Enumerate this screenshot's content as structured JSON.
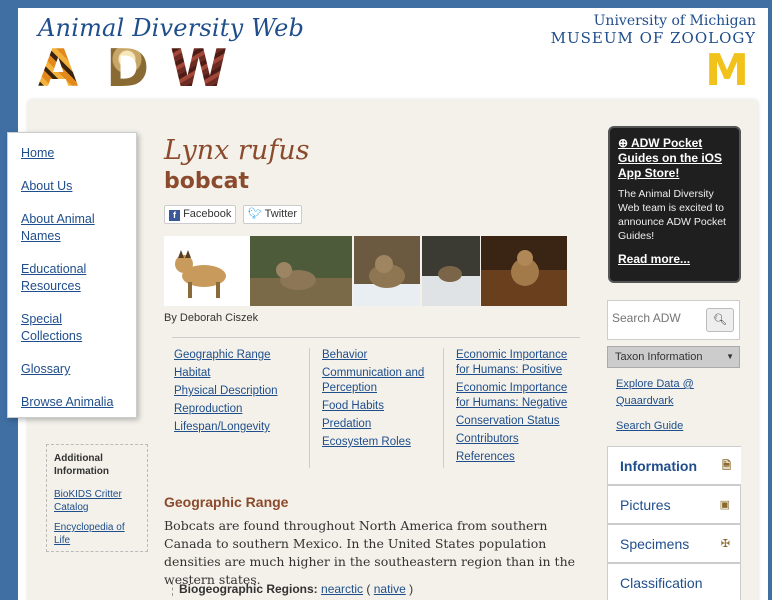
{
  "header": {
    "brand_title": "Animal Diversity Web",
    "brand_letters": [
      "A",
      "D",
      "W"
    ],
    "um_line1": "University of Michigan",
    "um_line2": "MUSEUM OF ZOOLOGY",
    "um_logo": "M"
  },
  "leftnav": {
    "items": [
      {
        "label": "Home"
      },
      {
        "label": "About Us"
      },
      {
        "label": "About Animal Names"
      },
      {
        "label": "Educational Resources"
      },
      {
        "label": "Special Collections"
      },
      {
        "label": "Glossary"
      },
      {
        "label": "Browse Animalia"
      }
    ]
  },
  "additional": {
    "title": "Additional Information",
    "links": [
      {
        "label": "BioKIDS Critter Catalog"
      },
      {
        "label": "Encyclopedia of Life"
      }
    ]
  },
  "species": {
    "scientific_name": "Lynx rufus",
    "common_name": "bobcat",
    "byline": "By Deborah Ciszek"
  },
  "share": {
    "facebook": "Facebook",
    "twitter": "Twitter"
  },
  "toc": {
    "col1": [
      "Geographic Range",
      "Habitat",
      "Physical Description",
      "Reproduction",
      "Lifespan/Longevity"
    ],
    "col2": [
      "Behavior",
      "Communication and Perception",
      "Food Habits",
      "Predation",
      "Ecosystem Roles"
    ],
    "col3": [
      "Economic Importance for Humans: Positive",
      "Economic Importance for Humans: Negative",
      "Conservation Status",
      "Contributors",
      "References"
    ]
  },
  "geographic_range": {
    "heading": "Geographic Range",
    "text": "Bobcats are found throughout North America from southern Canada to southern Mexico. In the United States population densities are much higher in the southeastern region than in the western states.",
    "regions_label": "Biogeographic Regions:",
    "region": "nearctic",
    "region_note": "native"
  },
  "ios_promo": {
    "title": "ADW Pocket Guides on the iOS App Store!",
    "body": "The Animal Diversity Web team is excited to announce ADW Pocket Guides!",
    "more": "Read more..."
  },
  "search": {
    "placeholder": "Search ADW"
  },
  "taxon_select": {
    "selected": "Taxon Information"
  },
  "right_links": [
    {
      "label": "Explore Data @ Quaardvark"
    },
    {
      "label": "Search Guide"
    }
  ],
  "tabs": [
    {
      "label": "Information",
      "active": true
    },
    {
      "label": "Pictures",
      "active": false
    },
    {
      "label": "Specimens",
      "active": false
    },
    {
      "label": "Classification",
      "active": false
    }
  ]
}
